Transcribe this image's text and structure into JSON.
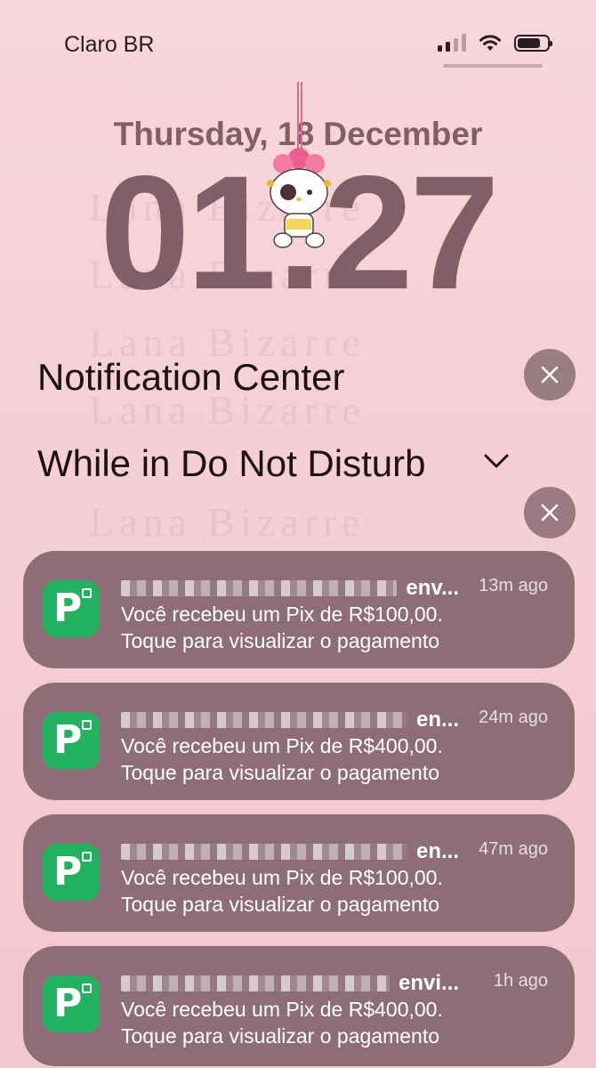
{
  "status_bar": {
    "carrier": "Claro BR",
    "icons": [
      "signal-icon",
      "wifi-icon",
      "battery-icon"
    ]
  },
  "lockscreen": {
    "date": "Thursday, 18 December",
    "time": "01:27",
    "watermark": "Lana Bizarre"
  },
  "notification_center": {
    "title": "Notification Center",
    "dnd_label": "While in Do Not Disturb"
  },
  "colors": {
    "background": "#f6cfd6",
    "notification_bg": "#866870",
    "app_icon_green": "#22b25f",
    "time_color": "#76545e"
  },
  "notifications": [
    {
      "app_icon": "picpay-icon",
      "sender_suffix": "env...",
      "time_ago": "13m ago",
      "line1": "Você recebeu um Pix de R$100,00.",
      "line2": "Toque para visualizar o pagamento"
    },
    {
      "app_icon": "picpay-icon",
      "sender_suffix": "en...",
      "time_ago": "24m ago",
      "line1": "Você recebeu um Pix de R$400,00.",
      "line2": "Toque para visualizar o pagamento"
    },
    {
      "app_icon": "picpay-icon",
      "sender_suffix": "en...",
      "time_ago": "47m ago",
      "line1": "Você recebeu um Pix de R$100,00.",
      "line2": "Toque para visualizar o pagamento"
    },
    {
      "app_icon": "picpay-icon",
      "sender_suffix": "envi...",
      "time_ago": "1h ago",
      "line1": "Você recebeu um Pix de R$400,00.",
      "line2": "Toque para visualizar o pagamento"
    }
  ]
}
